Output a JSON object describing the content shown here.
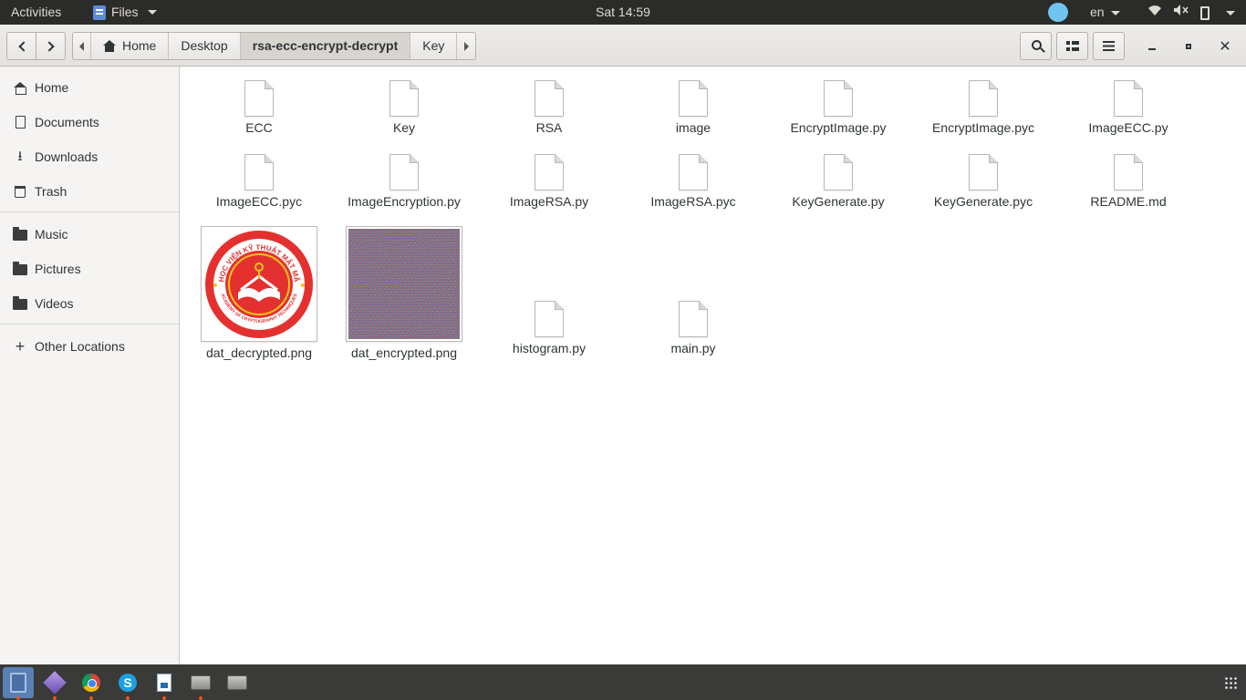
{
  "topbar": {
    "activities": "Activities",
    "app_name": "Files",
    "clock": "Sat 14:59",
    "language": "en"
  },
  "header": {
    "path": [
      "Home",
      "Desktop",
      "rsa-ecc-encrypt-decrypt",
      "Key"
    ],
    "active_path_index": 2
  },
  "sidebar": {
    "items": [
      {
        "label": "Home",
        "icon": "home-icon"
      },
      {
        "label": "Documents",
        "icon": "document-icon"
      },
      {
        "label": "Downloads",
        "icon": "download-icon"
      },
      {
        "label": "Trash",
        "icon": "trash-icon"
      },
      {
        "label": "Music",
        "icon": "folder-icon"
      },
      {
        "label": "Pictures",
        "icon": "folder-icon"
      },
      {
        "label": "Videos",
        "icon": "folder-icon"
      },
      {
        "label": "Other Locations",
        "icon": "plus-icon"
      }
    ]
  },
  "files": [
    {
      "name": "ECC",
      "icon": "file-icon"
    },
    {
      "name": "Key",
      "icon": "file-icon"
    },
    {
      "name": "RSA",
      "icon": "file-icon"
    },
    {
      "name": "image",
      "icon": "file-icon"
    },
    {
      "name": "EncryptImage.py",
      "icon": "file-icon"
    },
    {
      "name": "EncryptImage.pyc",
      "icon": "file-icon"
    },
    {
      "name": "ImageECC.py",
      "icon": "file-icon"
    },
    {
      "name": "ImageECC.pyc",
      "icon": "file-icon"
    },
    {
      "name": "ImageEncryption.py",
      "icon": "file-icon"
    },
    {
      "name": "ImageRSA.py",
      "icon": "file-icon"
    },
    {
      "name": "ImageRSA.pyc",
      "icon": "file-icon"
    },
    {
      "name": "KeyGenerate.py",
      "icon": "file-icon"
    },
    {
      "name": "KeyGenerate.pyc",
      "icon": "file-icon"
    },
    {
      "name": "README.md",
      "icon": "file-icon"
    },
    {
      "name": "dat_decrypted.png",
      "icon": "logo-thumbnail"
    },
    {
      "name": "dat_encrypted.png",
      "icon": "noise-thumbnail"
    },
    {
      "name": "histogram.py",
      "icon": "file-icon"
    },
    {
      "name": "main.py",
      "icon": "file-icon"
    }
  ],
  "logo": {
    "top_text": "HỌC VIỆN KỸ THUẬT MẬT MÃ",
    "bottom_text": "ACADEMY OF CRYPTOGRAPHY TECHNIQUES"
  },
  "dock": {
    "apps": [
      "files-icon",
      "gem-icon",
      "chrome-icon",
      "skype-icon",
      "document-icon",
      "drive-icon",
      "drive-icon"
    ]
  },
  "colors": {
    "topbar_bg": "#2b2b29",
    "dock_bg": "#3a3a38",
    "logo_red": "#e4312f",
    "accent": "#e95420"
  }
}
